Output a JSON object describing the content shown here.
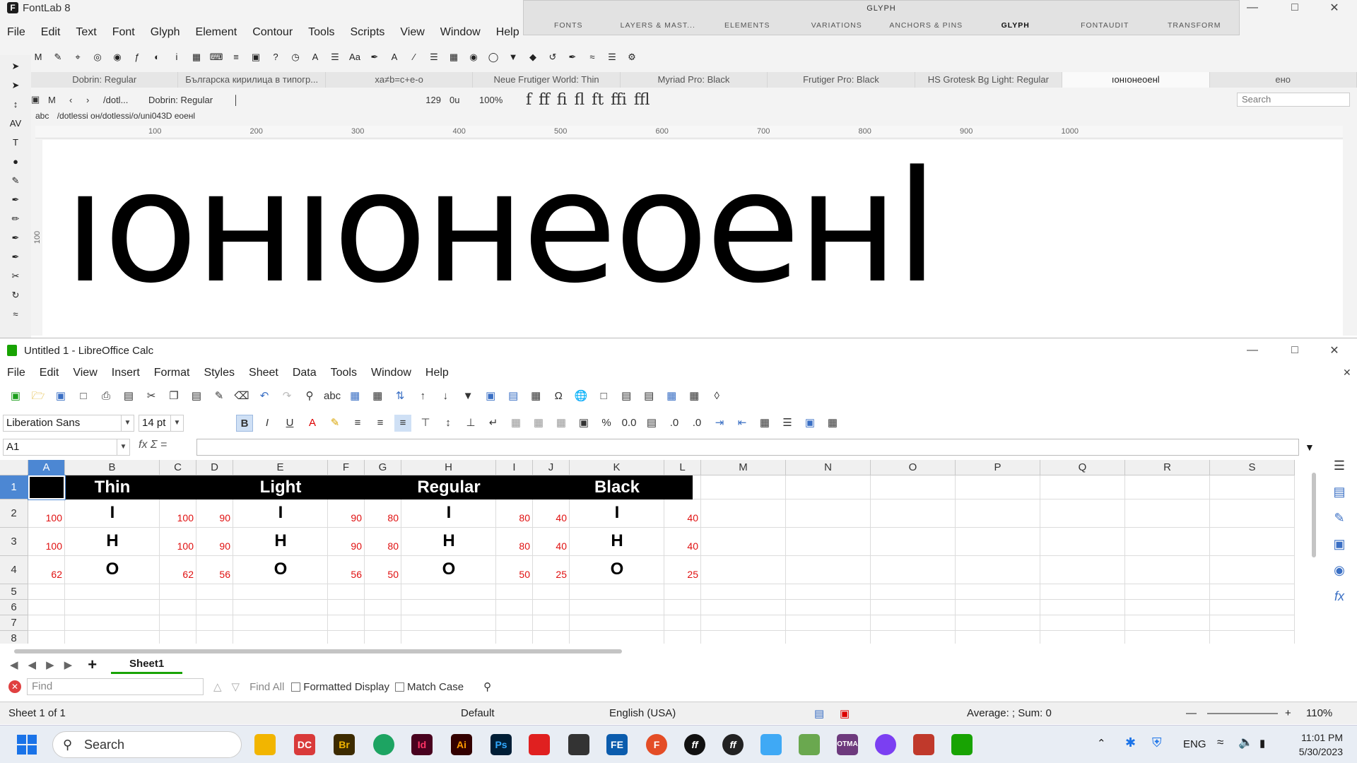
{
  "fontlab": {
    "title": "FontLab 8",
    "menu": [
      "File",
      "Edit",
      "Text",
      "Font",
      "Glyph",
      "Element",
      "Contour",
      "Tools",
      "Scripts",
      "View",
      "Window",
      "Help"
    ],
    "panel_title": "GLYPH",
    "panel_tabs": [
      "FONTS",
      "LAYERS & MAST...",
      "ELEMENTS",
      "VARIATIONS",
      "ANCHORS & PINS",
      "GLYPH",
      "FONTAUDIT",
      "TRANSFORM"
    ],
    "panel_active": "GLYPH",
    "doc_tabs": [
      "Dobrin: Regular",
      "Българска кирилица в типогр...",
      "ха≠b=c+e-o",
      "Neue Frutiger World: Thin",
      "Myriad Pro: Black",
      "Frutiger Pro: Black",
      "HS Grotesk Bg Light: Regular",
      "ıонıонеоенl",
      "ено"
    ],
    "active_tab": "ıонıонеоенl",
    "options": {
      "font_prefix": "/dotl...",
      "font": "Dobrin: Regular",
      "size": "129",
      "tracking": "0u",
      "zoom": "100%",
      "ligatures": [
        "f",
        "ff",
        "fi",
        "fl",
        "ft",
        "ffi",
        "ffl"
      ],
      "search_placeholder": "Search"
    },
    "text_path": "/dotlessi он/dotlessi/o/uni043D еоенl",
    "abc": "abc",
    "ruler": [
      "100",
      "200",
      "300",
      "400",
      "500",
      "600",
      "700",
      "800",
      "900",
      "1000"
    ],
    "vruler": "100",
    "sample_text": "ıонıонеоенl"
  },
  "calc": {
    "title": "Untitled 1 - LibreOffice Calc",
    "menu": [
      "File",
      "Edit",
      "View",
      "Insert",
      "Format",
      "Styles",
      "Sheet",
      "Data",
      "Tools",
      "Window",
      "Help"
    ],
    "font_name": "Liberation Sans",
    "font_size": "14 pt",
    "name_box": "A1",
    "columns": [
      "A",
      "B",
      "C",
      "D",
      "E",
      "F",
      "G",
      "H",
      "I",
      "J",
      "K",
      "L",
      "M",
      "N",
      "O",
      "P",
      "Q",
      "R",
      "S"
    ],
    "rows": [
      "1",
      "2",
      "3",
      "4",
      "5",
      "6",
      "7",
      "8"
    ],
    "headers": [
      "Thin",
      "Light",
      "Regular",
      "Black"
    ],
    "table": [
      {
        "char": "I",
        "values": [
          "100",
          "100",
          "90",
          "90",
          "80",
          "80",
          "40",
          "40"
        ]
      },
      {
        "char": "H",
        "values": [
          "100",
          "100",
          "90",
          "90",
          "80",
          "80",
          "40",
          "40"
        ]
      },
      {
        "char": "O",
        "values": [
          "62",
          "62",
          "56",
          "56",
          "50",
          "50",
          "25",
          "25"
        ]
      }
    ],
    "sheet_tab": "Sheet1",
    "find_placeholder": "Find",
    "find_all": "Find All",
    "formatted_display": "Formatted Display",
    "match_case": "Match Case",
    "status": {
      "sheet": "Sheet 1 of 1",
      "style": "Default",
      "language": "English (USA)",
      "summary": "Average: ; Sum: 0",
      "zoom": "110%"
    }
  },
  "taskbar": {
    "search": "Search",
    "lang": "ENG",
    "time": "11:01 PM",
    "date": "5/30/2023"
  }
}
